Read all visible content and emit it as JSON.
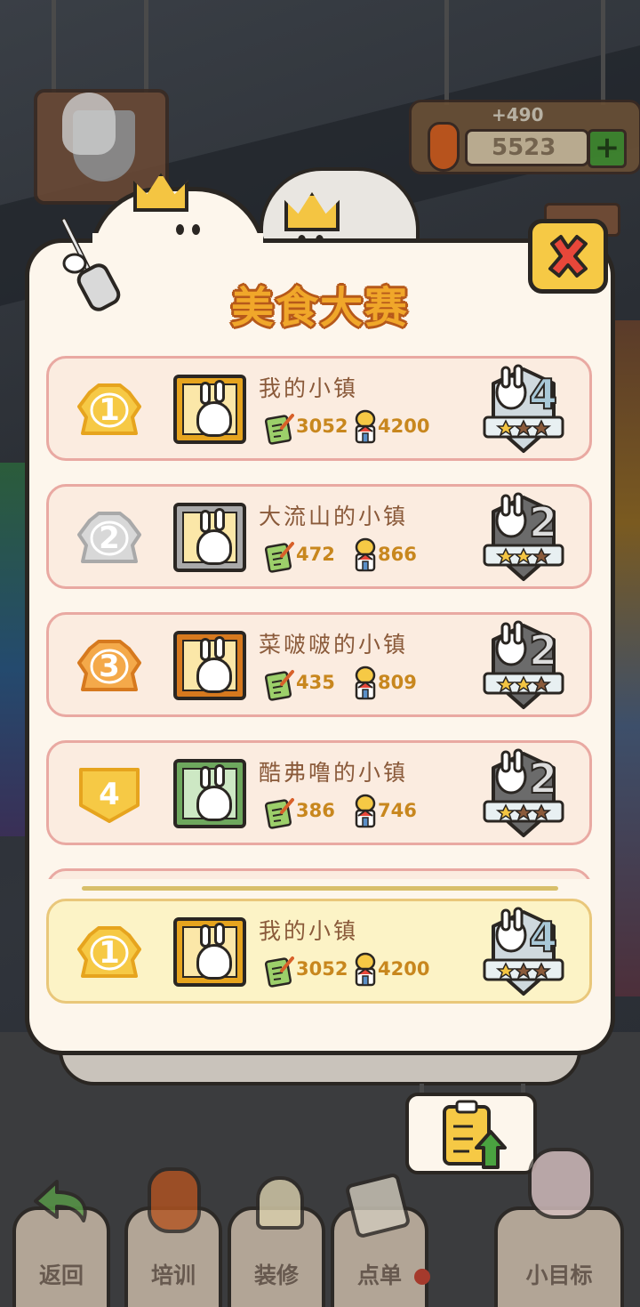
{
  "header": {
    "title": "美食大赛",
    "currency_gain": "+490",
    "currency_amount": "5523"
  },
  "colors": {
    "gold": "#f4c542",
    "silver": "#c9c9c9",
    "bronze": "#f2a540",
    "yellow_badge": "#f6c945",
    "stat_value": "#c8871e",
    "town_name": "#8a5a3a",
    "row_border": "#e9a9a2",
    "my_row_bg": "#fcf3c6"
  },
  "leaderboard": [
    {
      "rank": "1",
      "name": "我的小镇",
      "menu_score": "3052",
      "deco_score": "4200",
      "level": "4",
      "level_stars": 1
    },
    {
      "rank": "2",
      "name": "大流山的小镇",
      "menu_score": "472",
      "deco_score": "866",
      "level": "2",
      "level_stars": 2
    },
    {
      "rank": "3",
      "name": "菜啵啵的小镇",
      "menu_score": "435",
      "deco_score": "809",
      "level": "2",
      "level_stars": 2
    },
    {
      "rank": "4",
      "name": "酷弗噜的小镇",
      "menu_score": "386",
      "deco_score": "746",
      "level": "2",
      "level_stars": 1
    }
  ],
  "my_entry": {
    "rank": "1",
    "name": "我的小镇",
    "menu_score": "3052",
    "deco_score": "4200",
    "level": "4",
    "level_stars": 1
  },
  "nav": {
    "items": [
      {
        "label": "返回",
        "icon": "back-arrow-icon"
      },
      {
        "label": "培训",
        "icon": "carrot-trainer-icon"
      },
      {
        "label": "装修",
        "icon": "decorate-icon"
      },
      {
        "label": "点单",
        "icon": "order-icon"
      },
      {
        "label": "小目标",
        "icon": "goal-icon"
      }
    ]
  }
}
